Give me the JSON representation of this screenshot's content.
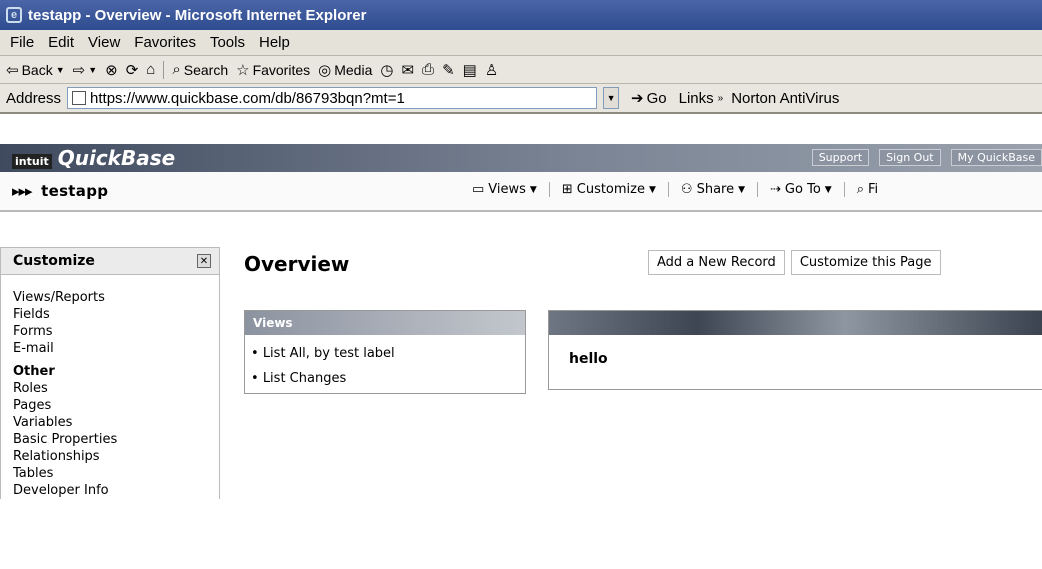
{
  "browser": {
    "title": "testapp - Overview - Microsoft Internet Explorer",
    "menu": [
      "File",
      "Edit",
      "View",
      "Favorites",
      "Tools",
      "Help"
    ],
    "toolbar": {
      "back": "Back",
      "search": "Search",
      "favorites": "Favorites",
      "media": "Media"
    },
    "address": {
      "label": "Address",
      "url": "https://www.quickbase.com/db/86793bqn?mt=1",
      "go": "Go",
      "links": "Links",
      "norton": "Norton AntiVirus"
    }
  },
  "qb": {
    "intuit": "intuit",
    "logo": "QuickBase",
    "support": "Support",
    "sign_out": "Sign Out",
    "my_qb": "My QuickBase"
  },
  "appbar": {
    "app_name": "testapp",
    "menus": {
      "views": "Views",
      "customize": "Customize",
      "share": "Share",
      "goto": "Go To",
      "find": "Fi"
    }
  },
  "sidebar": {
    "title": "Customize",
    "items": [
      "Views/Reports",
      "Fields",
      "Forms",
      "E-mail"
    ],
    "other_label": "Other",
    "other_items": [
      "Roles",
      "Pages",
      "Variables",
      "Basic Properties",
      "Relationships",
      "Tables",
      "Developer Info"
    ]
  },
  "main": {
    "title": "Overview",
    "actions": {
      "add_record": "Add a New Record",
      "customize_page": "Customize this Page"
    },
    "views_box": {
      "title": "Views",
      "items": [
        "List All, by test label",
        "List Changes"
      ]
    },
    "hello_box": {
      "text": "hello"
    }
  }
}
